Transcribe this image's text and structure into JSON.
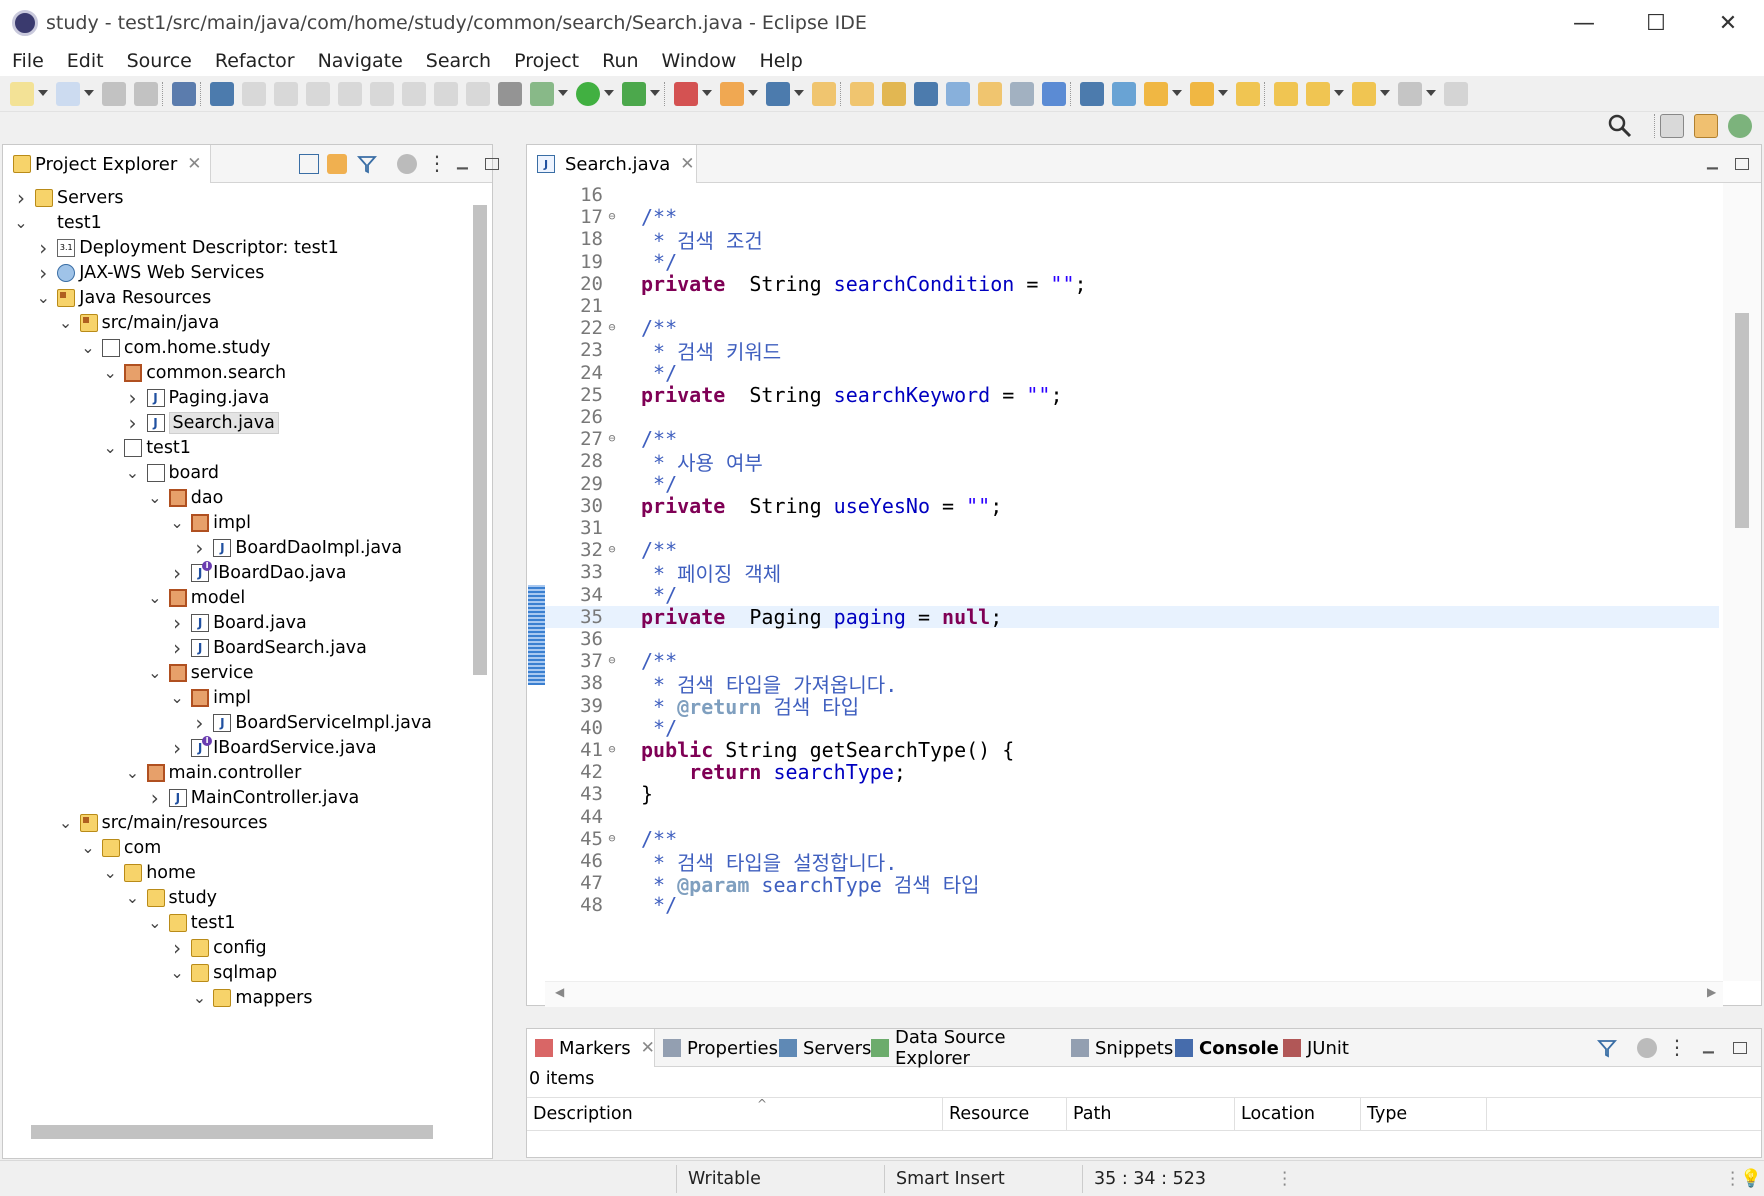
{
  "window": {
    "title": "study - test1/src/main/java/com/home/study/common/search/Search.java - Eclipse IDE",
    "minimize": "—",
    "maximize": "☐",
    "close": "✕"
  },
  "menu": [
    "File",
    "Edit",
    "Source",
    "Refactor",
    "Navigate",
    "Search",
    "Project",
    "Run",
    "Window",
    "Help"
  ],
  "project_explorer": {
    "tab_label": "Project Explorer",
    "tree": [
      {
        "indent": 0,
        "twisty": "›",
        "icon": "folder",
        "label": "Servers"
      },
      {
        "indent": 0,
        "twisty": "⌄",
        "icon": "project",
        "label": "test1"
      },
      {
        "indent": 1,
        "twisty": "›",
        "icon": "dd",
        "label": "Deployment Descriptor: test1"
      },
      {
        "indent": 1,
        "twisty": "›",
        "icon": "ws",
        "label": "JAX-WS Web Services"
      },
      {
        "indent": 1,
        "twisty": "⌄",
        "icon": "srcfolder",
        "label": "Java Resources"
      },
      {
        "indent": 2,
        "twisty": "⌄",
        "icon": "srcfolder",
        "label": "src/main/java"
      },
      {
        "indent": 3,
        "twisty": "⌄",
        "icon": "pkg-empty",
        "label": "com.home.study"
      },
      {
        "indent": 4,
        "twisty": "⌄",
        "icon": "pkg",
        "label": "common.search"
      },
      {
        "indent": 5,
        "twisty": "›",
        "icon": "java",
        "label": "Paging.java"
      },
      {
        "indent": 5,
        "twisty": "›",
        "icon": "java",
        "label": "Search.java",
        "selected": true
      },
      {
        "indent": 4,
        "twisty": "⌄",
        "icon": "pkg-empty",
        "label": "test1"
      },
      {
        "indent": 5,
        "twisty": "⌄",
        "icon": "pkg-empty",
        "label": "board"
      },
      {
        "indent": 6,
        "twisty": "⌄",
        "icon": "pkg",
        "label": "dao"
      },
      {
        "indent": 7,
        "twisty": "⌄",
        "icon": "pkg",
        "label": "impl"
      },
      {
        "indent": 8,
        "twisty": "›",
        "icon": "java",
        "label": "BoardDaoImpl.java"
      },
      {
        "indent": 7,
        "twisty": "›",
        "icon": "iface",
        "label": "IBoardDao.java"
      },
      {
        "indent": 6,
        "twisty": "⌄",
        "icon": "pkg",
        "label": "model"
      },
      {
        "indent": 7,
        "twisty": "›",
        "icon": "java",
        "label": "Board.java"
      },
      {
        "indent": 7,
        "twisty": "›",
        "icon": "java",
        "label": "BoardSearch.java"
      },
      {
        "indent": 6,
        "twisty": "⌄",
        "icon": "pkg",
        "label": "service"
      },
      {
        "indent": 7,
        "twisty": "⌄",
        "icon": "pkg",
        "label": "impl"
      },
      {
        "indent": 8,
        "twisty": "›",
        "icon": "java",
        "label": "BoardServiceImpl.java"
      },
      {
        "indent": 7,
        "twisty": "›",
        "icon": "iface",
        "label": "IBoardService.java"
      },
      {
        "indent": 5,
        "twisty": "⌄",
        "icon": "pkg",
        "label": "main.controller"
      },
      {
        "indent": 6,
        "twisty": "›",
        "icon": "java",
        "label": "MainController.java"
      },
      {
        "indent": 2,
        "twisty": "⌄",
        "icon": "srcfolder",
        "label": "src/main/resources"
      },
      {
        "indent": 3,
        "twisty": "⌄",
        "icon": "folder",
        "label": "com"
      },
      {
        "indent": 4,
        "twisty": "⌄",
        "icon": "folder",
        "label": "home"
      },
      {
        "indent": 5,
        "twisty": "⌄",
        "icon": "folder",
        "label": "study"
      },
      {
        "indent": 6,
        "twisty": "⌄",
        "icon": "folder",
        "label": "test1"
      },
      {
        "indent": 7,
        "twisty": "›",
        "icon": "folder",
        "label": "config"
      },
      {
        "indent": 7,
        "twisty": "⌄",
        "icon": "folder",
        "label": "sqlmap"
      },
      {
        "indent": 8,
        "twisty": "⌄",
        "icon": "folder",
        "label": "mappers"
      }
    ]
  },
  "editor": {
    "tab_label": "Search.java",
    "current_line": 35,
    "lines": [
      {
        "n": "16",
        "fold": false,
        "parts": []
      },
      {
        "n": "17",
        "fold": true,
        "parts": [
          [
            "cm",
            "/**"
          ]
        ]
      },
      {
        "n": "18",
        "fold": false,
        "parts": [
          [
            "cm",
            " * 검색 조건"
          ]
        ]
      },
      {
        "n": "19",
        "fold": false,
        "parts": [
          [
            "cm",
            " */"
          ]
        ]
      },
      {
        "n": "20",
        "fold": false,
        "parts": [
          [
            "kw",
            "private"
          ],
          [
            "",
            "  String "
          ],
          [
            "fld",
            "searchCondition"
          ],
          [
            "",
            " = "
          ],
          [
            "str",
            "\"\""
          ],
          [
            "",
            ";"
          ]
        ]
      },
      {
        "n": "21",
        "fold": false,
        "parts": []
      },
      {
        "n": "22",
        "fold": true,
        "parts": [
          [
            "cm",
            "/**"
          ]
        ]
      },
      {
        "n": "23",
        "fold": false,
        "parts": [
          [
            "cm",
            " * 검색 키워드"
          ]
        ]
      },
      {
        "n": "24",
        "fold": false,
        "parts": [
          [
            "cm",
            " */"
          ]
        ]
      },
      {
        "n": "25",
        "fold": false,
        "parts": [
          [
            "kw",
            "private"
          ],
          [
            "",
            "  String "
          ],
          [
            "fld",
            "searchKeyword"
          ],
          [
            "",
            " = "
          ],
          [
            "str",
            "\"\""
          ],
          [
            "",
            ";"
          ]
        ]
      },
      {
        "n": "26",
        "fold": false,
        "parts": []
      },
      {
        "n": "27",
        "fold": true,
        "parts": [
          [
            "cm",
            "/**"
          ]
        ]
      },
      {
        "n": "28",
        "fold": false,
        "parts": [
          [
            "cm",
            " * 사용 여부"
          ]
        ]
      },
      {
        "n": "29",
        "fold": false,
        "parts": [
          [
            "cm",
            " */"
          ]
        ]
      },
      {
        "n": "30",
        "fold": false,
        "parts": [
          [
            "kw",
            "private"
          ],
          [
            "",
            "  String "
          ],
          [
            "fld",
            "useYesNo"
          ],
          [
            "",
            " = "
          ],
          [
            "str",
            "\"\""
          ],
          [
            "",
            ";"
          ]
        ]
      },
      {
        "n": "31",
        "fold": false,
        "parts": []
      },
      {
        "n": "32",
        "fold": true,
        "parts": [
          [
            "cm",
            "/**"
          ]
        ]
      },
      {
        "n": "33",
        "fold": false,
        "parts": [
          [
            "cm",
            " * 페이징 객체"
          ]
        ]
      },
      {
        "n": "34",
        "fold": false,
        "parts": [
          [
            "cm",
            " */"
          ]
        ]
      },
      {
        "n": "35",
        "fold": false,
        "parts": [
          [
            "kw",
            "private"
          ],
          [
            "",
            "  Paging "
          ],
          [
            "fld",
            "paging"
          ],
          [
            "",
            " = "
          ],
          [
            "kw",
            "null"
          ],
          [
            "",
            ";"
          ]
        ]
      },
      {
        "n": "36",
        "fold": false,
        "parts": []
      },
      {
        "n": "37",
        "fold": true,
        "parts": [
          [
            "cm",
            "/**"
          ]
        ]
      },
      {
        "n": "38",
        "fold": false,
        "parts": [
          [
            "cm",
            " * 검색 타입을 가져옵니다."
          ]
        ]
      },
      {
        "n": "39",
        "fold": false,
        "parts": [
          [
            "cm",
            " * "
          ],
          [
            "jdtag",
            "@return"
          ],
          [
            "cm",
            " 검색 타입"
          ]
        ]
      },
      {
        "n": "40",
        "fold": false,
        "parts": [
          [
            "cm",
            " */"
          ]
        ]
      },
      {
        "n": "41",
        "fold": true,
        "parts": [
          [
            "kw",
            "public"
          ],
          [
            "",
            " String getSearchType() {"
          ]
        ]
      },
      {
        "n": "42",
        "fold": false,
        "parts": [
          [
            "",
            "    "
          ],
          [
            "kw",
            "return"
          ],
          [
            "",
            " "
          ],
          [
            "fld",
            "searchType"
          ],
          [
            "",
            ";"
          ]
        ]
      },
      {
        "n": "43",
        "fold": false,
        "parts": [
          [
            "",
            "}"
          ]
        ]
      },
      {
        "n": "44",
        "fold": false,
        "parts": []
      },
      {
        "n": "45",
        "fold": true,
        "parts": [
          [
            "cm",
            "/**"
          ]
        ]
      },
      {
        "n": "46",
        "fold": false,
        "parts": [
          [
            "cm",
            " * 검색 타입을 설정합니다."
          ]
        ]
      },
      {
        "n": "47",
        "fold": false,
        "parts": [
          [
            "cm",
            " * "
          ],
          [
            "jdtag",
            "@param"
          ],
          [
            "cm",
            " searchType 검색 타입"
          ]
        ]
      },
      {
        "n": "48",
        "fold": false,
        "parts": [
          [
            "cm",
            " */"
          ]
        ]
      }
    ]
  },
  "bottom_panel": {
    "tabs": [
      {
        "label": "Markers",
        "active": false,
        "closable": true
      },
      {
        "label": "Properties"
      },
      {
        "label": "Servers"
      },
      {
        "label": "Data Source Explorer"
      },
      {
        "label": "Snippets"
      },
      {
        "label": "Console",
        "active": true
      },
      {
        "label": "JUnit"
      }
    ],
    "items_count": "0 items",
    "columns": [
      "Description",
      "Resource",
      "Path",
      "Location",
      "Type"
    ]
  },
  "status": {
    "writable": "Writable",
    "insert_mode": "Smart Insert",
    "position": "35 : 34 : 523"
  }
}
